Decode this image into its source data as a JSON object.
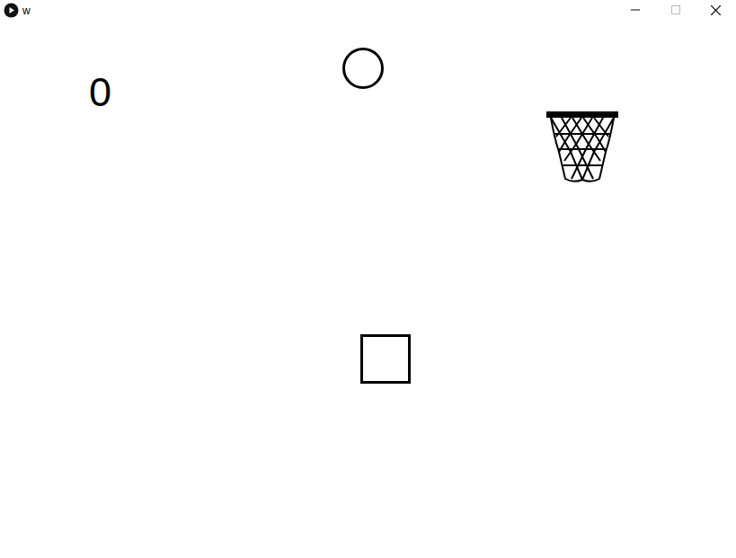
{
  "window": {
    "title": "w"
  },
  "score": "0"
}
